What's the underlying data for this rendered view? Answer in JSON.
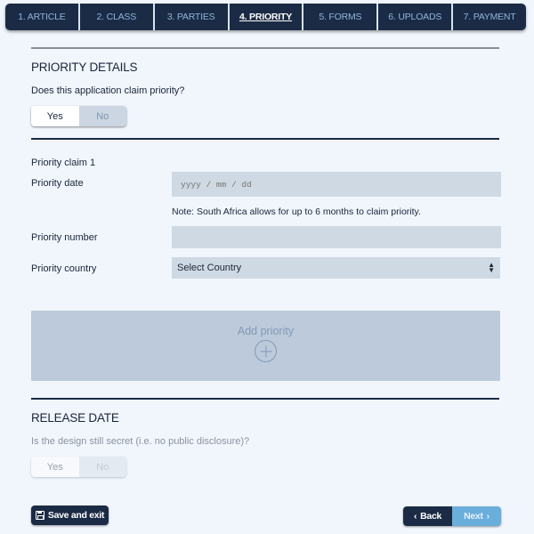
{
  "tabs": [
    {
      "label": "1. ARTICLE",
      "active": false
    },
    {
      "label": "2. CLASS",
      "active": false
    },
    {
      "label": "3. PARTIES",
      "active": false
    },
    {
      "label": "4. PRIORITY",
      "active": true
    },
    {
      "label": "5. FORMS",
      "active": false
    },
    {
      "label": "6. UPLOADS",
      "active": false
    },
    {
      "label": "7. PAYMENT",
      "active": false
    }
  ],
  "priority_details": {
    "title": "PRIORITY DETAILS",
    "question": "Does this application claim priority?",
    "toggle": {
      "yes": "Yes",
      "no": "No",
      "selected": "Yes"
    }
  },
  "claim": {
    "heading": "Priority claim 1",
    "date_label": "Priority date",
    "date_placeholder": "yyyy / mm / dd",
    "note": "Note: South Africa allows for up to 6 months to claim priority.",
    "number_label": "Priority number",
    "number_value": "",
    "country_label": "Priority country",
    "country_selected": "Select Country"
  },
  "add_priority": {
    "label": "Add priority",
    "icon": "plus-circle-icon"
  },
  "release_date": {
    "title": "RELEASE DATE",
    "question": "Is the design still secret (i.e. no public disclosure)?",
    "toggle": {
      "yes": "Yes",
      "no": "No",
      "disabled": true
    }
  },
  "footer": {
    "save_label": "Save and exit",
    "save_icon": "floppy-disk-icon",
    "back_label": "Back",
    "next_label": "Next"
  }
}
